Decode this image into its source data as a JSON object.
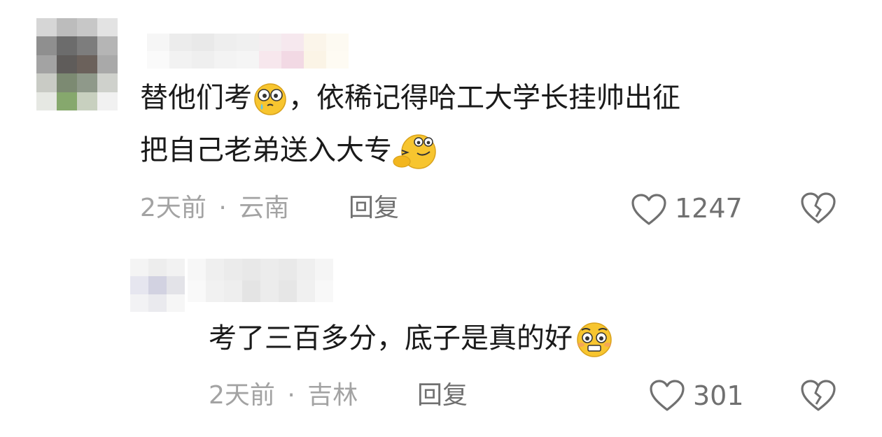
{
  "comments": [
    {
      "line1_a": "替他们考",
      "line1_b": "，依稀记得哈工大学长挂帅出征",
      "line2": "把自己老弟送入大专",
      "emoji1": "teary-eyes-emoji",
      "emoji2": "thinking-grin-emoji",
      "time": "2天前",
      "dot": "·",
      "location": "云南",
      "reply_label": "回复",
      "likes": "1247"
    },
    {
      "text": "考了三百多分，底子是真的好",
      "emoji": "pleading-face-emoji",
      "time": "2天前",
      "dot": "·",
      "location": "吉林",
      "reply_label": "回复",
      "likes": "301"
    }
  ],
  "colors": {
    "text": "#1a1a1a",
    "meta": "#a3a3a3",
    "action": "#707070",
    "emoji": "#f6c232"
  }
}
